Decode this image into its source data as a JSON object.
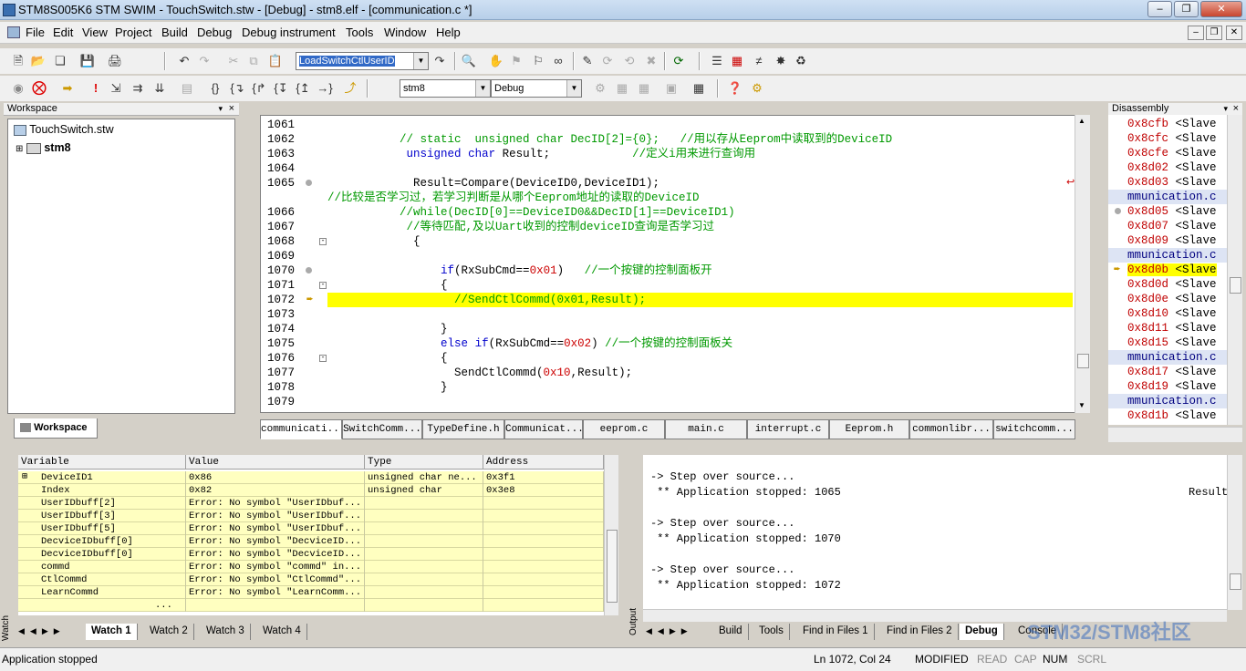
{
  "window": {
    "title": "STM8S005K6 STM SWIM - TouchSwitch.stw - [Debug] - stm8.elf - [communication.c *]"
  },
  "menu": [
    "File",
    "Edit",
    "View",
    "Project",
    "Build",
    "Debug",
    "Debug instrument",
    "Tools",
    "Window",
    "Help"
  ],
  "toolbar": {
    "function_combo": "LoadSwitchCtlUserID",
    "target_combo": "stm8",
    "config_combo": "Debug"
  },
  "workspace": {
    "header": "Workspace",
    "root": "TouchSwitch.stw",
    "project": "stm8",
    "tab": "Workspace"
  },
  "editor": {
    "lines": [
      {
        "n": "1061",
        "text": ""
      },
      {
        "n": "1062",
        "text": "            // static  unsigned char DecID[2]={0};   //用以存从Eeprom中读取到的DeviceID"
      },
      {
        "n": "1063",
        "text": "             unsigned char Result;            //定义i用来进行查询用"
      },
      {
        "n": "1064",
        "text": ""
      },
      {
        "n": "1065",
        "text": "              Result=Compare(DeviceID0,DeviceID1);"
      },
      {
        "n": "",
        "text": "//比较是否学习过，若学习判断是从哪个Eeprom地址的读取的DeviceID"
      },
      {
        "n": "1066",
        "text": "            //while(DecID[0]==DeviceID0&&DecID[1]==DeviceID1)"
      },
      {
        "n": "1067",
        "text": "             //等待匹配,及以Uart收到的控制deviceID查询是否学习过"
      },
      {
        "n": "1068",
        "text": "              {"
      },
      {
        "n": "1069",
        "text": ""
      },
      {
        "n": "1070",
        "text": "                  if(RxSubCmd==0x01)   //一个按键的控制面板开"
      },
      {
        "n": "1071",
        "text": "                  {"
      },
      {
        "n": "1072",
        "text": "                    //SendCtlCommd(0x01,Result);"
      },
      {
        "n": "1073",
        "text": ""
      },
      {
        "n": "1074",
        "text": "                  }"
      },
      {
        "n": "1075",
        "text": "                  else if(RxSubCmd==0x02) //一个按键的控制面板关"
      },
      {
        "n": "1076",
        "text": "                  {"
      },
      {
        "n": "1077",
        "text": "                    SendCtlCommd(0x10,Result);"
      },
      {
        "n": "1078",
        "text": "                  }"
      },
      {
        "n": "1079",
        "text": ""
      }
    ],
    "tabs": [
      "communicati...",
      "SwitchComm...",
      "TypeDefine.h",
      "Communicat...",
      "eeprom.c",
      "main.c",
      "interrupt.c",
      "Eeprom.h",
      "commonlibr...",
      "switchcomm..."
    ]
  },
  "disassembly": {
    "header": "Disassembly",
    "lines": [
      {
        "addr": "0x8cfb",
        "rest": " <Slave"
      },
      {
        "addr": "0x8cfc",
        "rest": " <Slave"
      },
      {
        "addr": "0x8cfe",
        "rest": " <Slave"
      },
      {
        "addr": "0x8d02",
        "rest": " <Slave"
      },
      {
        "addr": "0x8d03",
        "rest": " <Slave"
      },
      {
        "addr": "mmunication.c",
        "rest": ""
      },
      {
        "addr": "0x8d05",
        "rest": " <Slave"
      },
      {
        "addr": "0x8d07",
        "rest": " <Slave"
      },
      {
        "addr": "0x8d09",
        "rest": " <Slave"
      },
      {
        "addr": "mmunication.c",
        "rest": ""
      },
      {
        "addr": "0x8d0b",
        "rest": " <Slave"
      },
      {
        "addr": "0x8d0d",
        "rest": " <Slave"
      },
      {
        "addr": "0x8d0e",
        "rest": " <Slave"
      },
      {
        "addr": "0x8d10",
        "rest": " <Slave"
      },
      {
        "addr": "0x8d11",
        "rest": " <Slave"
      },
      {
        "addr": "0x8d15",
        "rest": " <Slave"
      },
      {
        "addr": "mmunication.c",
        "rest": ""
      },
      {
        "addr": "0x8d17",
        "rest": " <Slave"
      },
      {
        "addr": "0x8d19",
        "rest": " <Slave"
      },
      {
        "addr": "mmunication.c",
        "rest": ""
      },
      {
        "addr": "0x8d1b",
        "rest": " <Slave"
      }
    ]
  },
  "watch": {
    "columns": [
      "Variable",
      "Value",
      "Type",
      "Address"
    ],
    "rows": [
      {
        "var": "DeviceID1",
        "val": "0x86",
        "type": "unsigned char ne...",
        "addr": "0x3f1"
      },
      {
        "var": "Index",
        "val": "0x82",
        "type": "unsigned char",
        "addr": "0x3e8"
      },
      {
        "var": "UserIDbuff[2]",
        "val": "Error: No symbol \"UserIDbuf...",
        "type": "",
        "addr": ""
      },
      {
        "var": "UserIDbuff[3]",
        "val": "Error: No symbol \"UserIDbuf...",
        "type": "",
        "addr": ""
      },
      {
        "var": "UserIDbuff[5]",
        "val": "Error: No symbol \"UserIDbuf...",
        "type": "",
        "addr": ""
      },
      {
        "var": "DecviceIDbuff[0]",
        "val": "Error: No symbol \"DecviceID...",
        "type": "",
        "addr": ""
      },
      {
        "var": "DecviceIDbuff[0]",
        "val": "Error: No symbol \"DecviceID...",
        "type": "",
        "addr": ""
      },
      {
        "var": "commd",
        "val": "Error: No symbol \"commd\" in...",
        "type": "",
        "addr": ""
      },
      {
        "var": "CtlCommd",
        "val": "Error: No symbol \"CtlCommd\"...",
        "type": "",
        "addr": ""
      },
      {
        "var": "LearnCommd",
        "val": "Error: No symbol \"LearnComm...",
        "type": "",
        "addr": ""
      },
      {
        "var": "...",
        "val": "",
        "type": "",
        "addr": ""
      }
    ],
    "tabs": [
      "Watch 1",
      "Watch 2",
      "Watch 3",
      "Watch 4"
    ],
    "side_label": "Watch"
  },
  "output": {
    "lines": [
      "-> Step over source...",
      " ** Application stopped: 1065",
      "",
      "-> Step over source...",
      " ** Application stopped: 1070",
      "",
      "-> Step over source...",
      " ** Application stopped: 1072"
    ],
    "result_fragment": "Result",
    "tabs": [
      "Build",
      "Tools",
      "Find in Files 1",
      "Find in Files 2",
      "Debug",
      "Console"
    ],
    "side_label": "Output"
  },
  "status": {
    "message": "Application stopped",
    "position": "Ln 1072, Col 24",
    "modified": "MODIFIED",
    "read": "READ",
    "cap": "CAP",
    "num": "NUM",
    "scrl": "SCRL"
  },
  "watermark": "STM32/STM8社区",
  "colors": {
    "highlight": "#ffff00",
    "keyword": "#0000cc",
    "comment": "#009900",
    "number": "#cc0000",
    "watch_bg": "#ffffc0"
  }
}
